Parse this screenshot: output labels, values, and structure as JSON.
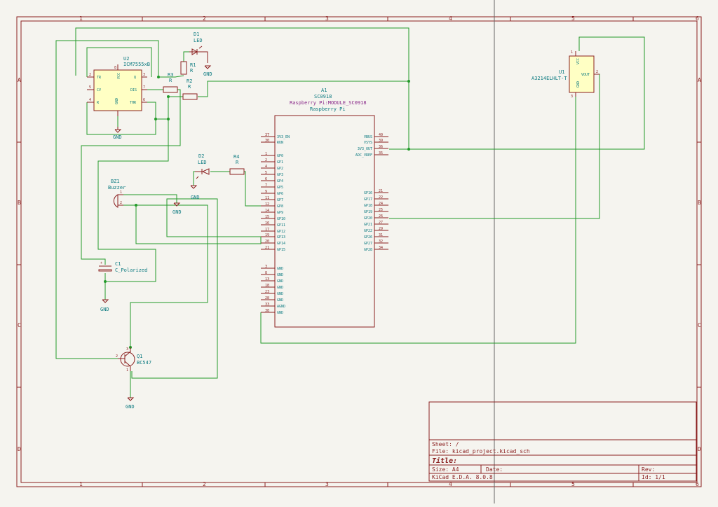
{
  "border": {
    "cols": [
      "1",
      "2",
      "3",
      "4",
      "5",
      "6"
    ],
    "rows": [
      "A",
      "B",
      "C",
      "D"
    ]
  },
  "components": {
    "u2": {
      "ref": "U2",
      "value": "ICM7555xB",
      "pins": {
        "tr": "TR",
        "cv": "CV",
        "r": "R",
        "vcc": "VCC",
        "gnd": "GND",
        "q": "Q",
        "dis": "DIS",
        "thr": "THR"
      },
      "nums": {
        "p2": "2",
        "p5": "5",
        "p4": "4",
        "p8": "8",
        "p1": "1",
        "p3": "3",
        "p7": "7",
        "p6": "6"
      }
    },
    "d1": {
      "ref": "D1",
      "value": "LED"
    },
    "r1": {
      "ref": "R1",
      "value": "R"
    },
    "r3": {
      "ref": "R3",
      "value": "R"
    },
    "r2": {
      "ref": "R2",
      "value": "R"
    },
    "d2": {
      "ref": "D2",
      "value": "LED"
    },
    "r4": {
      "ref": "R4",
      "value": "R"
    },
    "bz1": {
      "ref": "BZ1",
      "value": "Buzzer",
      "p1": "1",
      "p2": "2"
    },
    "c1": {
      "ref": "C1",
      "value": "C_Polarized",
      "plus": "+"
    },
    "q1": {
      "ref": "Q1",
      "value": "BC547",
      "p1": "1",
      "p2": "2",
      "p3": "3"
    },
    "u1": {
      "ref": "U1",
      "value": "A3214ELHLT-T",
      "vcc": "VCC",
      "gnd": "GND",
      "vout": "VOUT",
      "p1": "1",
      "p2": "2",
      "p3": "3"
    },
    "a1": {
      "ref": "A1",
      "value": "SC0918",
      "footprint": "Raspberry Pi:MODULE_SC0918",
      "desc": "Raspberry Pi",
      "left_pins": [
        {
          "num": "37",
          "name": "3V3_EN"
        },
        {
          "num": "30",
          "name": "RUN"
        },
        {
          "num": "1",
          "name": "GP0"
        },
        {
          "num": "2",
          "name": "GP1"
        },
        {
          "num": "4",
          "name": "GP2"
        },
        {
          "num": "5",
          "name": "GP3"
        },
        {
          "num": "6",
          "name": "GP4"
        },
        {
          "num": "7",
          "name": "GP5"
        },
        {
          "num": "9",
          "name": "GP6"
        },
        {
          "num": "11",
          "name": "GP7"
        },
        {
          "num": "12",
          "name": "GP8"
        },
        {
          "num": "14",
          "name": "GP9"
        },
        {
          "num": "15",
          "name": "GP10"
        },
        {
          "num": "16",
          "name": "GP11"
        },
        {
          "num": "17",
          "name": "GP12"
        },
        {
          "num": "19",
          "name": "GP13"
        },
        {
          "num": "20",
          "name": "GP14"
        },
        {
          "num": "21",
          "name": "GP15"
        },
        {
          "num": "3",
          "name": "GND"
        },
        {
          "num": "8",
          "name": "GND"
        },
        {
          "num": "13",
          "name": "GND"
        },
        {
          "num": "18",
          "name": "GND"
        },
        {
          "num": "23",
          "name": "GND"
        },
        {
          "num": "28",
          "name": "GND"
        },
        {
          "num": "33",
          "name": "AGND"
        },
        {
          "num": "38",
          "name": "GND"
        }
      ],
      "right_pins": [
        {
          "num": "40",
          "name": "VBUS"
        },
        {
          "num": "39",
          "name": "VSYS"
        },
        {
          "num": "36",
          "name": "3V3_OUT"
        },
        {
          "num": "35",
          "name": "ADC_VREF"
        },
        {
          "num": "21",
          "name": "GP16"
        },
        {
          "num": "22",
          "name": "GP17"
        },
        {
          "num": "24",
          "name": "GP18"
        },
        {
          "num": "25",
          "name": "GP19"
        },
        {
          "num": "26",
          "name": "GP20"
        },
        {
          "num": "27",
          "name": "GP21"
        },
        {
          "num": "29",
          "name": "GP22"
        },
        {
          "num": "31",
          "name": "GP26"
        },
        {
          "num": "32",
          "name": "GP27"
        },
        {
          "num": "34",
          "name": "GP28"
        }
      ]
    },
    "gnd_label": "GND"
  },
  "title_block": {
    "sheet": "Sheet: /",
    "file": "File: kicad_project.kicad_sch",
    "title": "Title:",
    "size": "Size: A4",
    "date": "Date:",
    "rev": "Rev:",
    "tool": "KiCad E.D.A. 8.0.8",
    "id": "Id: 1/1"
  }
}
